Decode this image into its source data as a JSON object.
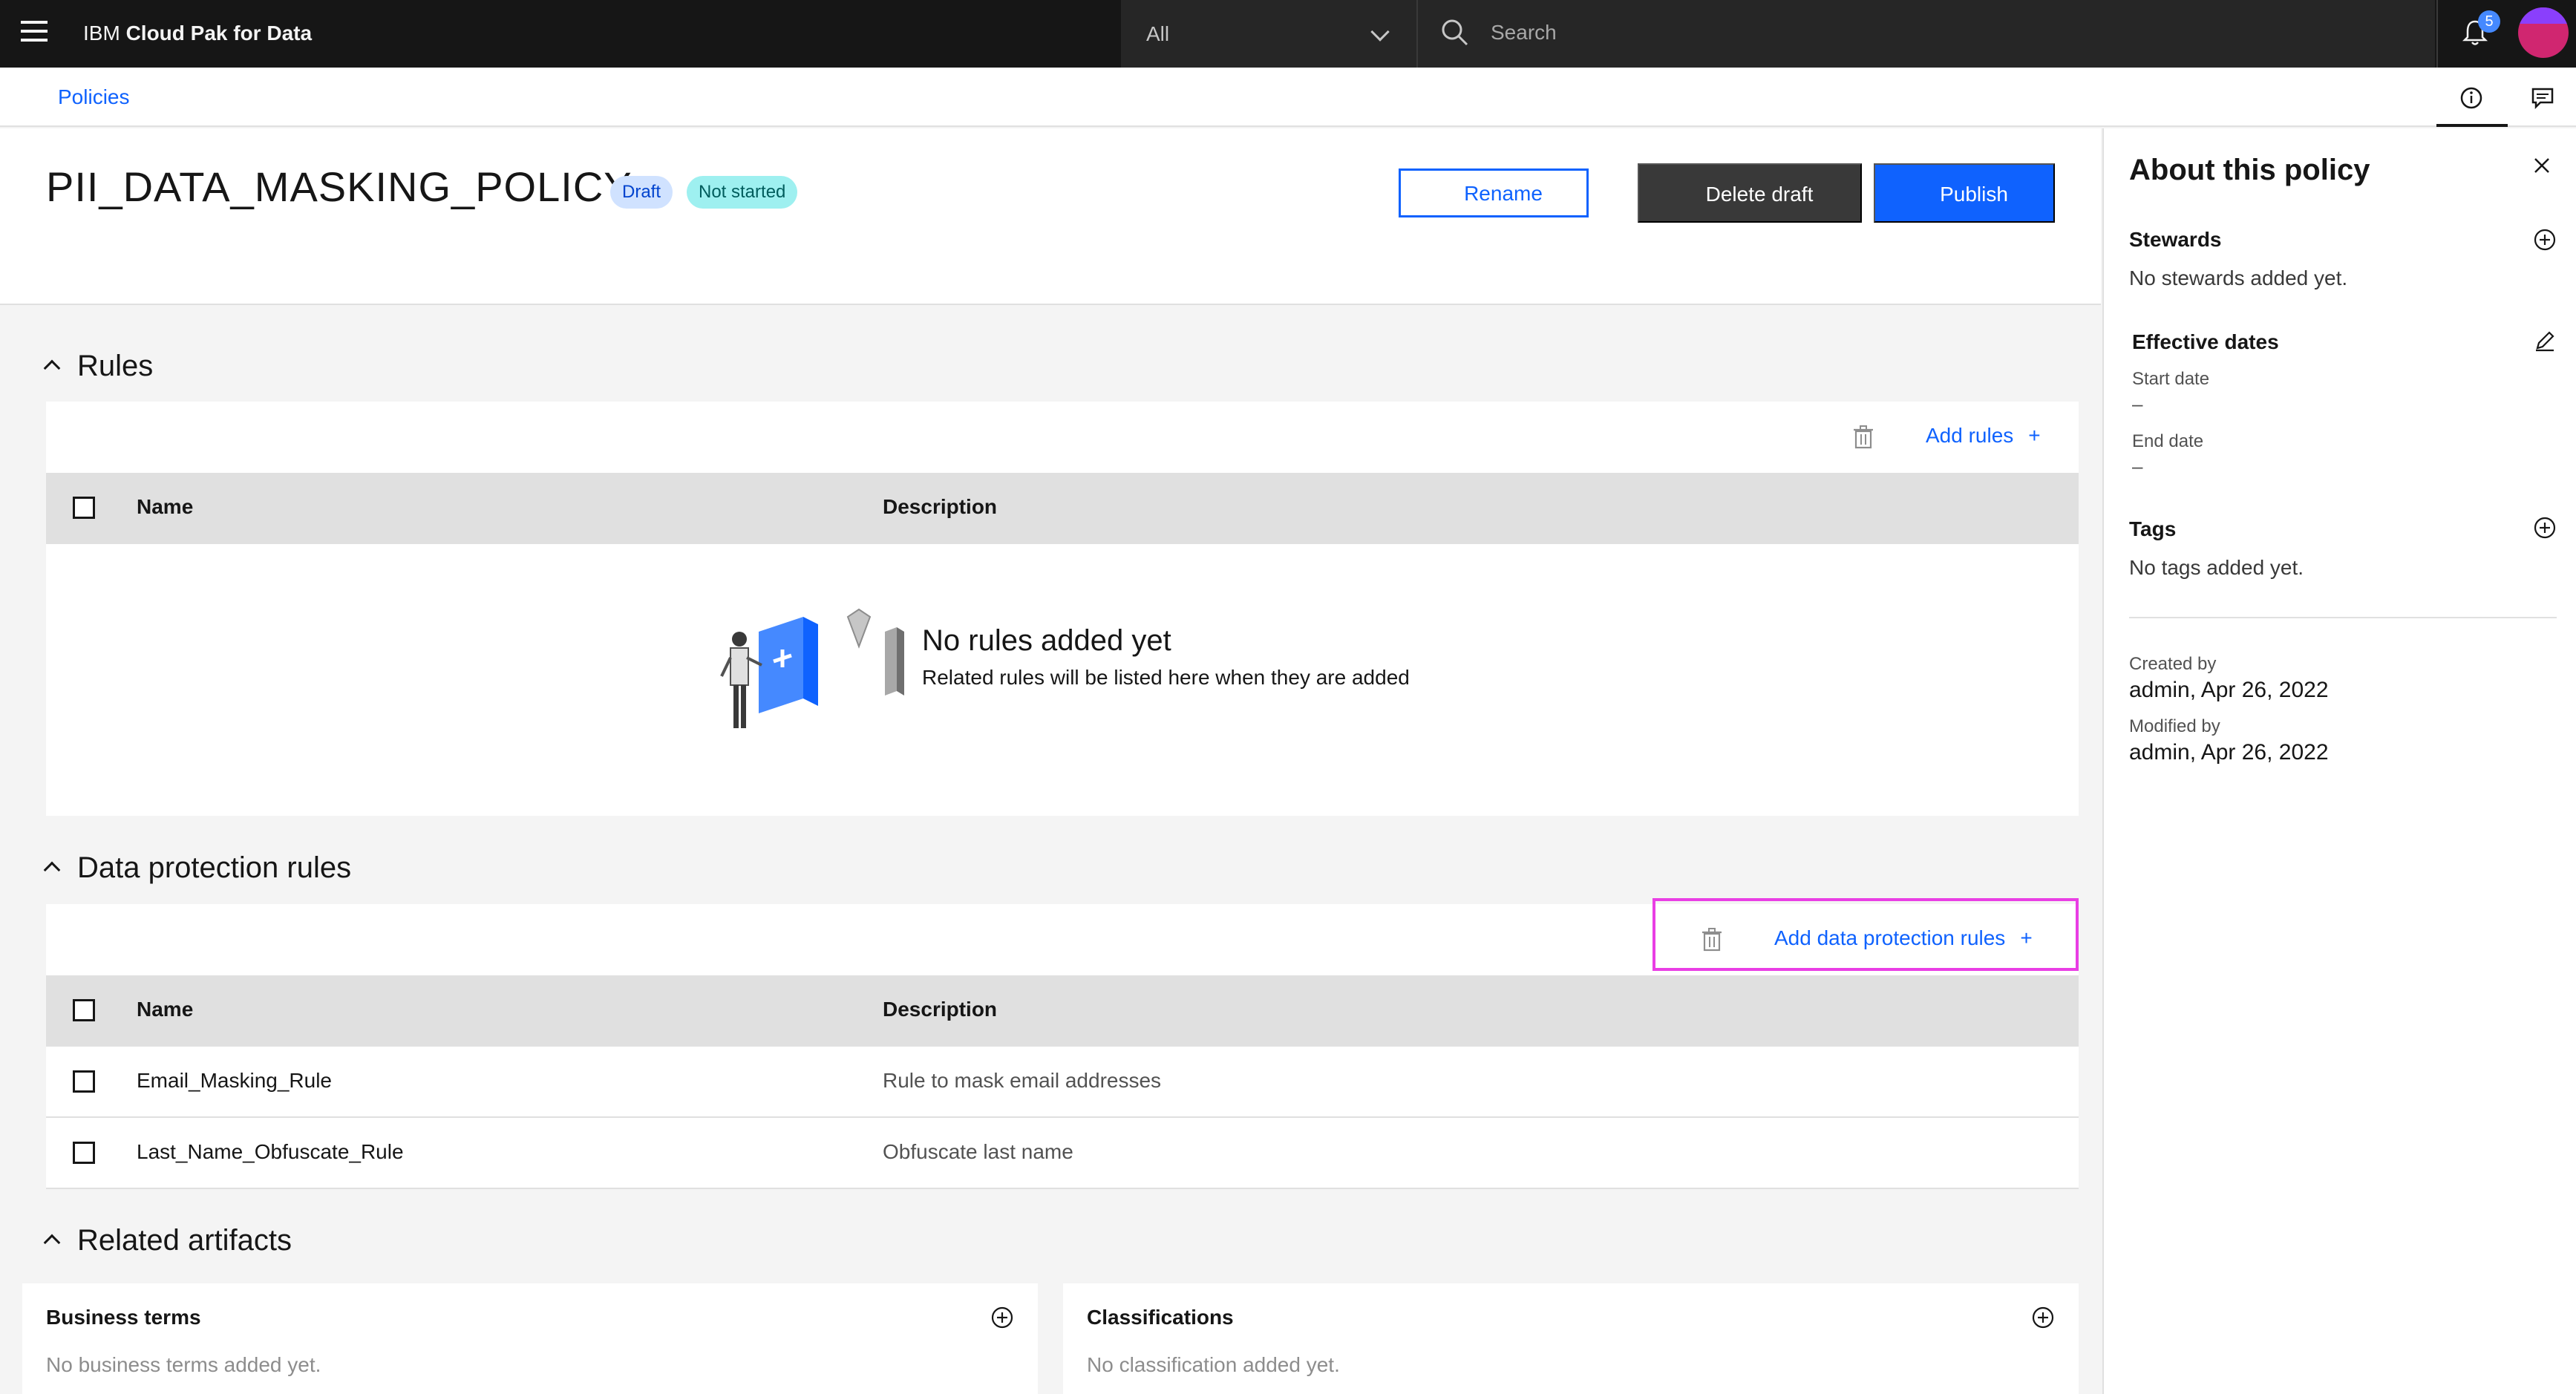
{
  "header": {
    "brand_prefix": "IBM",
    "brand_name": "Cloud Pak for Data",
    "scope_value": "All",
    "search_placeholder": "Search",
    "notification_count": "5"
  },
  "breadcrumb": {
    "item": "Policies"
  },
  "policy": {
    "title": "PII_DATA_MASKING_POLICY",
    "tag_draft": "Draft",
    "tag_status": "Not started",
    "rename_label": "Rename",
    "delete_label": "Delete draft",
    "publish_label": "Publish"
  },
  "rules": {
    "heading": "Rules",
    "add_label": "Add rules",
    "columns": [
      "Name",
      "Description"
    ],
    "empty_title": "No rules added yet",
    "empty_subtitle": "Related rules will be listed here when they are added"
  },
  "dp_rules": {
    "heading": "Data protection rules",
    "add_label": "Add data protection rules",
    "columns": [
      "Name",
      "Description"
    ],
    "rows": [
      {
        "name": "Email_Masking_Rule",
        "description": "Rule to mask email addresses"
      },
      {
        "name": "Last_Name_Obfuscate_Rule",
        "description": "Obfuscate last name"
      }
    ]
  },
  "artifacts": {
    "heading": "Related artifacts",
    "business_terms": {
      "title": "Business terms",
      "empty": "No business terms added yet."
    },
    "classifications": {
      "title": "Classifications",
      "empty": "No classification added yet."
    }
  },
  "side_panel": {
    "title": "About this policy",
    "stewards_label": "Stewards",
    "stewards_empty": "No stewards added yet.",
    "effective_label": "Effective dates",
    "start_label": "Start date",
    "start_value": "–",
    "end_label": "End date",
    "end_value": "–",
    "tags_label": "Tags",
    "tags_empty": "No tags added yet.",
    "created_label": "Created by",
    "created_value": "admin, Apr 26, 2022",
    "modified_label": "Modified by",
    "modified_value": "admin, Apr 26, 2022"
  },
  "colors": {
    "accent": "#0f62fe",
    "highlight": "#e93ee4",
    "header_bg": "#161616"
  }
}
